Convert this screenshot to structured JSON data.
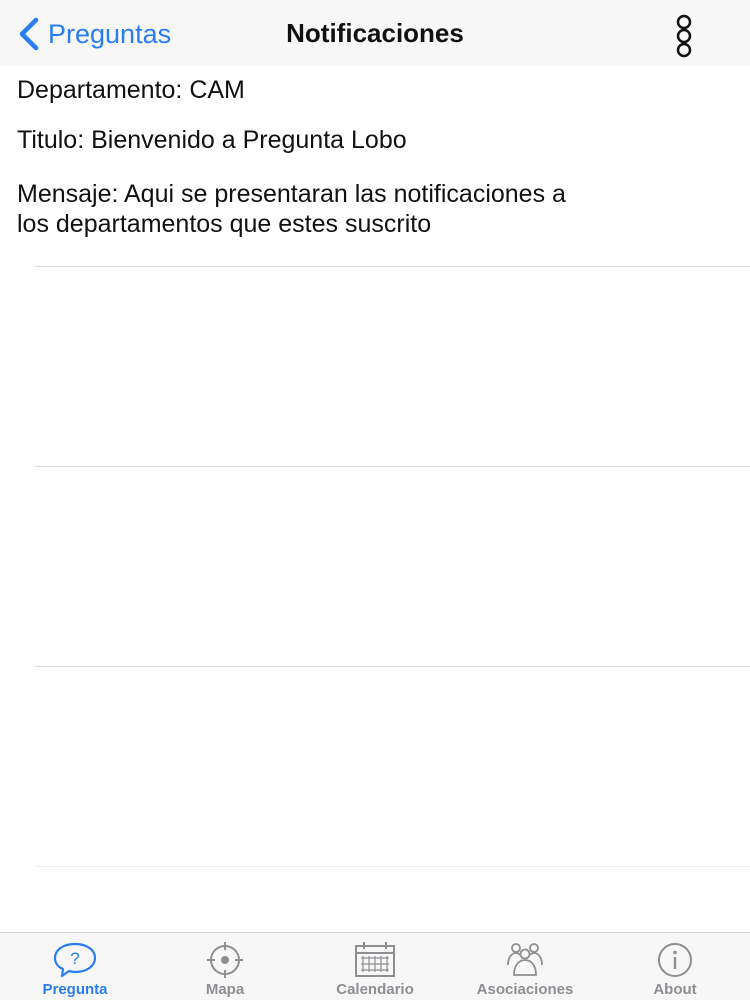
{
  "navbar": {
    "back_label": "Preguntas",
    "title": "Notificaciones",
    "more_icon": "more-vertical-icon"
  },
  "notification": {
    "department": "Departamento: CAM",
    "title": "Titulo: Bienvenido a Pregunta Lobo",
    "message_line1": "Mensaje: Aqui se presentaran las notificaciones a",
    "message_line2": "los departamentos que estes suscrito"
  },
  "tabs": [
    {
      "label": "Pregunta",
      "icon": "question-bubble-icon",
      "active": true
    },
    {
      "label": "Mapa",
      "icon": "crosshair-icon",
      "active": false
    },
    {
      "label": "Calendario",
      "icon": "calendar-icon",
      "active": false
    },
    {
      "label": "Asociaciones",
      "icon": "group-icon",
      "active": false
    },
    {
      "label": "About",
      "icon": "info-icon",
      "active": false
    }
  ],
  "colors": {
    "accent": "#2a7df0",
    "inactive": "#8e8e93",
    "bar_background": "#f7f7f7"
  }
}
